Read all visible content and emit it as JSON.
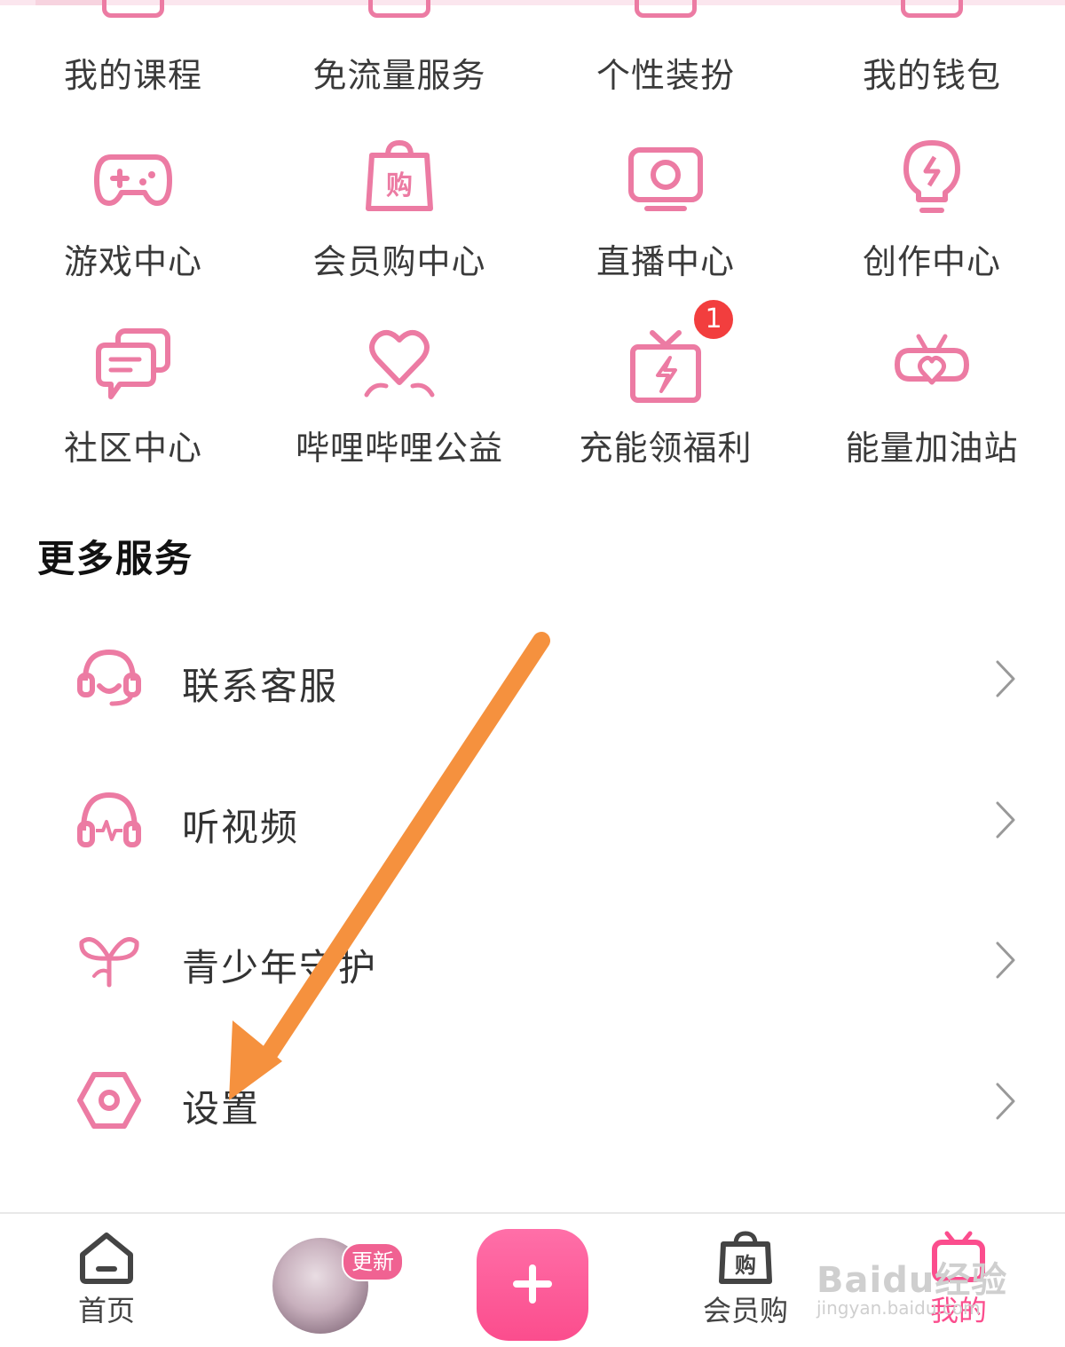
{
  "grid": [
    {
      "label": "我的课程",
      "icon": "course-icon"
    },
    {
      "label": "免流量服务",
      "icon": "free-data-icon"
    },
    {
      "label": "个性装扮",
      "icon": "dress-up-icon"
    },
    {
      "label": "我的钱包",
      "icon": "wallet-icon"
    },
    {
      "label": "游戏中心",
      "icon": "gamepad-icon"
    },
    {
      "label": "会员购中心",
      "icon": "shopping-bag-icon"
    },
    {
      "label": "直播中心",
      "icon": "live-tv-icon"
    },
    {
      "label": "创作中心",
      "icon": "lightbulb-icon"
    },
    {
      "label": "社区中心",
      "icon": "chat-bubbles-icon"
    },
    {
      "label": "哔哩哔哩公益",
      "icon": "heart-charity-icon"
    },
    {
      "label": "充能领福利",
      "icon": "gift-icon",
      "badge": "1"
    },
    {
      "label": "能量加油站",
      "icon": "heart-tv-icon"
    }
  ],
  "more_services": {
    "title": "更多服务",
    "items": [
      {
        "label": "联系客服",
        "icon": "headset-icon"
      },
      {
        "label": "听视频",
        "icon": "headphones-icon"
      },
      {
        "label": "青少年守护",
        "icon": "sprout-icon"
      },
      {
        "label": "设置",
        "icon": "settings-icon"
      }
    ]
  },
  "tabbar": {
    "home": "首页",
    "update_badge": "更新",
    "mall": "会员购",
    "mine": "我的"
  },
  "watermark": {
    "brand": "Baidu经验",
    "url": "jingyan.baidu.com"
  },
  "colors": {
    "accent": "#fb4d8d",
    "icon_pink": "#ec7ba3",
    "arrow": "#f5913e",
    "badge_red": "#f23e3e"
  }
}
